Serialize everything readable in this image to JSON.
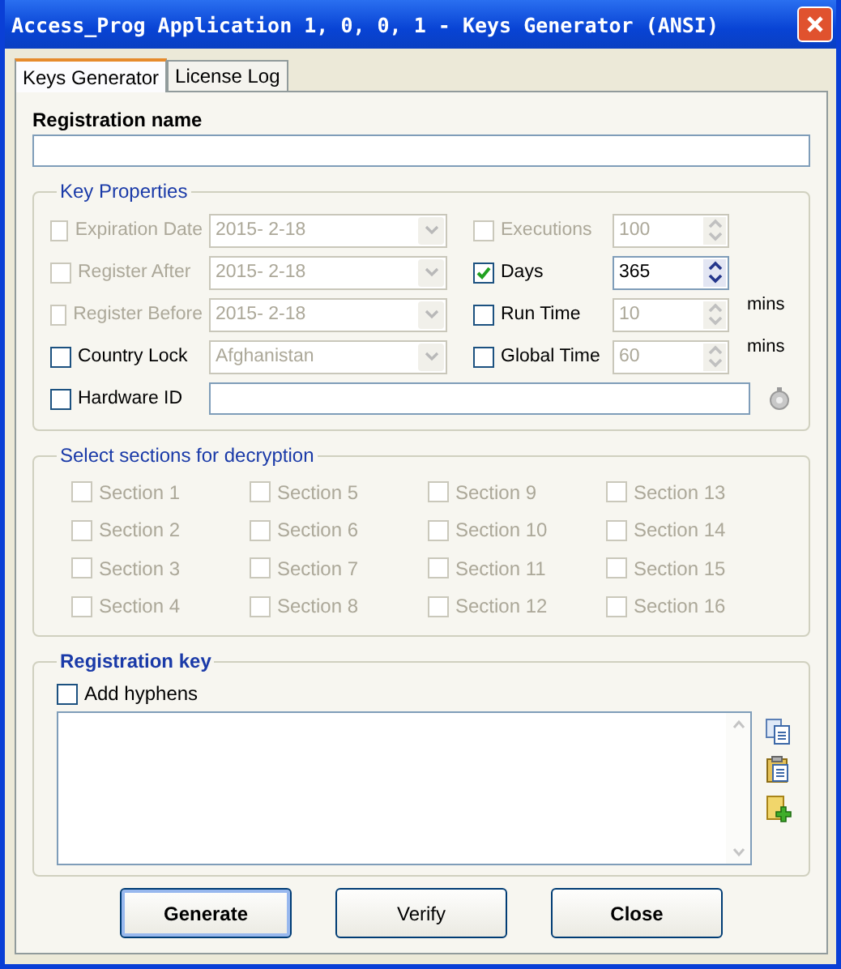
{
  "window": {
    "title": "Access_Prog Application 1, 0, 0, 1 - Keys Generator (ANSI)"
  },
  "tabs": [
    {
      "label": "Keys Generator",
      "selected": true
    },
    {
      "label": "License Log",
      "selected": false
    }
  ],
  "registration_name": {
    "label": "Registration name"
  },
  "key_properties": {
    "title": "Key Properties",
    "rows": [
      {
        "left": {
          "label": "Expiration Date",
          "checked": false,
          "disabled": true
        },
        "combo": {
          "value": "2015-  2-18",
          "disabled": true
        },
        "right": {
          "label": "Executions",
          "checked": false,
          "disabled": true
        },
        "spinner": {
          "value": "100",
          "disabled": true
        }
      },
      {
        "left": {
          "label": "Register After",
          "checked": false,
          "disabled": true
        },
        "combo": {
          "value": "2015-  2-18",
          "disabled": true
        },
        "right": {
          "label": "Days",
          "checked": true,
          "disabled": false
        },
        "spinner": {
          "value": "365",
          "disabled": false
        }
      },
      {
        "left": {
          "label": "Register Before",
          "checked": false,
          "disabled": true
        },
        "combo": {
          "value": "2015-  2-18",
          "disabled": true
        },
        "right": {
          "label": "Run Time",
          "checked": false,
          "disabled": false
        },
        "spinner": {
          "value": "10",
          "disabled": true
        },
        "unit": "mins"
      },
      {
        "left": {
          "label": "Country Lock",
          "checked": false,
          "disabled": false
        },
        "combo": {
          "value": "Afghanistan",
          "disabled": true
        },
        "right": {
          "label": "Global Time",
          "checked": false,
          "disabled": false
        },
        "spinner": {
          "value": "60",
          "disabled": true
        },
        "unit": "mins"
      }
    ],
    "hardware_id": {
      "label": "Hardware ID",
      "checked": false,
      "disabled": false
    }
  },
  "sections": {
    "title": "Select sections for decryption",
    "items": [
      {
        "label": "Section 1",
        "checked": false,
        "disabled": true
      },
      {
        "label": "Section 2",
        "checked": false,
        "disabled": true
      },
      {
        "label": "Section 3",
        "checked": false,
        "disabled": true
      },
      {
        "label": "Section 4",
        "checked": false,
        "disabled": true
      },
      {
        "label": "Section 5",
        "checked": false,
        "disabled": true
      },
      {
        "label": "Section 6",
        "checked": false,
        "disabled": true
      },
      {
        "label": "Section 7",
        "checked": false,
        "disabled": true
      },
      {
        "label": "Section 8",
        "checked": false,
        "disabled": true
      },
      {
        "label": "Section 9",
        "checked": false,
        "disabled": true
      },
      {
        "label": "Section 10",
        "checked": false,
        "disabled": true
      },
      {
        "label": "Section 11",
        "checked": false,
        "disabled": true
      },
      {
        "label": "Section 12",
        "checked": false,
        "disabled": true
      },
      {
        "label": "Section 13",
        "checked": false,
        "disabled": true
      },
      {
        "label": "Section 14",
        "checked": false,
        "disabled": true
      },
      {
        "label": "Section 15",
        "checked": false,
        "disabled": true
      },
      {
        "label": "Section 16",
        "checked": false,
        "disabled": true
      }
    ]
  },
  "registration_key": {
    "title": "Registration key",
    "add_hyphens": {
      "label": "Add hyphens",
      "checked": false,
      "disabled": false
    }
  },
  "buttons": [
    {
      "label": "Generate",
      "bold": true,
      "default": true
    },
    {
      "label": "Verify",
      "bold": false,
      "default": false
    },
    {
      "label": "Close",
      "bold": true,
      "default": false
    }
  ]
}
